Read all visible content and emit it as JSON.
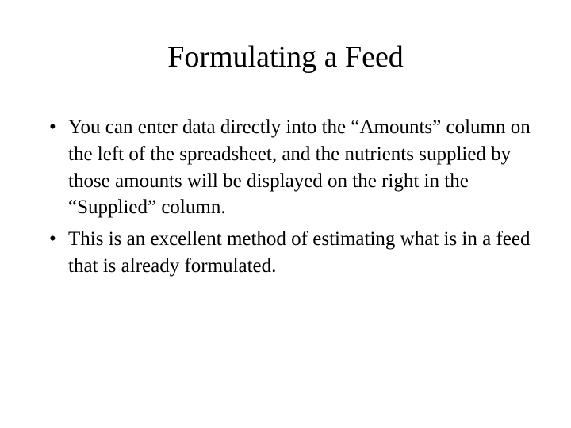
{
  "slide": {
    "title": "Formulating a Feed",
    "bullets": [
      "You can enter data directly into the “Amounts” column on the left of the spreadsheet, and the nutrients supplied by those amounts will be displayed on the right in the “Supplied” column.",
      "This is an excellent method of estimating what is in a feed that is already formulated."
    ]
  }
}
